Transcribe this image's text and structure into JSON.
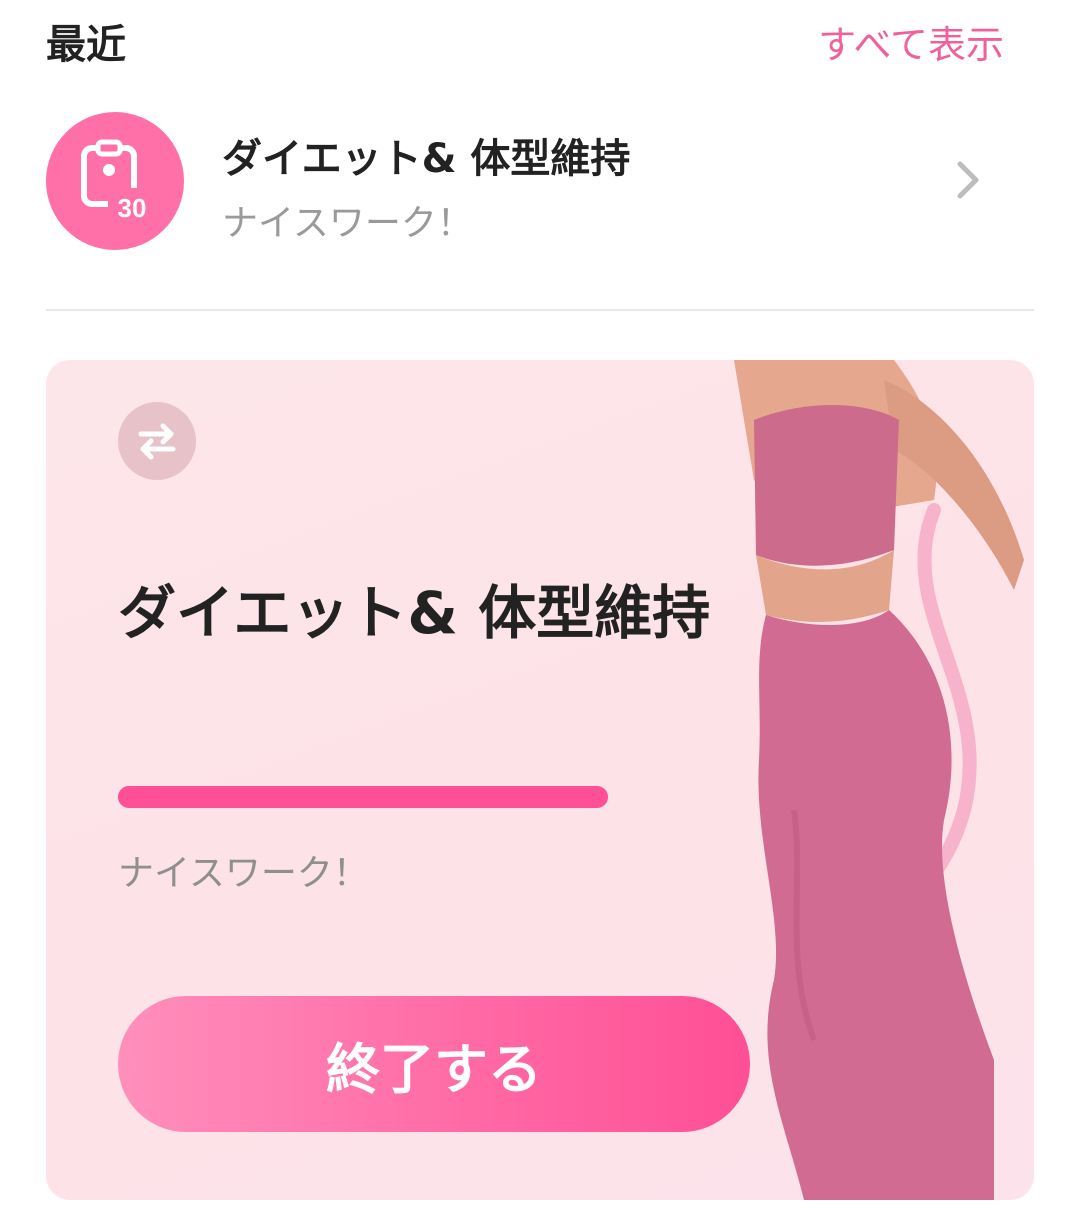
{
  "header": {
    "title": "最近",
    "view_all_label": "すべて表示"
  },
  "recent_item": {
    "name": "ダイエット& 体型維持",
    "subtitle": "ナイスワーク！",
    "icon": "clipboard-30-day-icon",
    "icon_badge": "30"
  },
  "card": {
    "title": "ダイエット& 体型維持",
    "progress_percent": 100,
    "subtitle": "ナイスワーク！",
    "finish_button_label": "終了する",
    "switch_icon": "swap-arrows-icon",
    "illustration": "pink-workout-outfit-woman"
  },
  "colors": {
    "accent": "#ff4f95",
    "link": "#f0609a",
    "icon_circle": "#ff6fa8",
    "card_bg": "#fde6ea"
  }
}
